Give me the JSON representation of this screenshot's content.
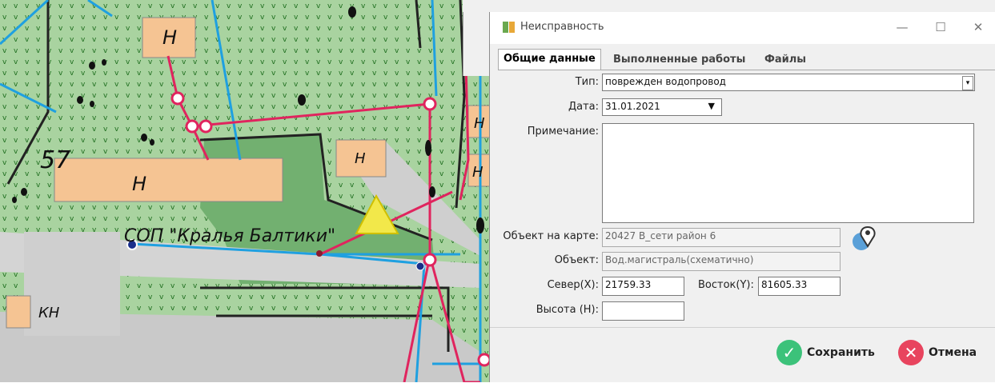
{
  "map": {
    "labels": {
      "house_label": "Н",
      "kn_label": "КН",
      "number_label": "57",
      "place_label": "СОП \"Кралья Балтики\""
    },
    "colors": {
      "green": "#8fbc8a",
      "light_green": "#b3d9a8",
      "salmon": "#f7c08f",
      "red_line": "#e0245e",
      "blue_line": "#1fa0e0",
      "road": "#d8d8d8"
    }
  },
  "dialog": {
    "title": "Неисправность",
    "window_buttons": {
      "minimize": "—",
      "maximize": "☐",
      "close": "✕"
    },
    "tabs": [
      "Общие данные",
      "Выполненные работы",
      "Файлы"
    ],
    "form": {
      "type_label": "Тип:",
      "type_value": "поврежден водопровод",
      "date_label": "Дата:",
      "date_value": "31.01.2021",
      "note_label": "Примечание:",
      "note_value": "",
      "map_object_label": "Объект на карте:",
      "map_object_value": "20427 В_сети район 6",
      "object_label": "Объект:",
      "object_value": "Вод.магистраль(схематично)",
      "north_label": "Север(X):",
      "north_value": "21759.33",
      "east_label": "Восток(Y):",
      "east_value": "81605.33",
      "height_label": "Высота (H):",
      "height_value": ""
    },
    "buttons": {
      "save": "Сохранить",
      "cancel": "Отмена"
    }
  }
}
